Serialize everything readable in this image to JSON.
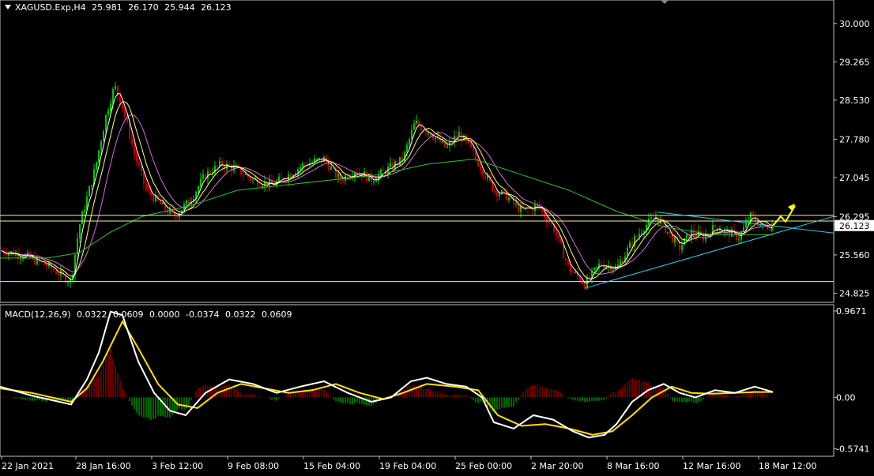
{
  "header": {
    "symbol": "XAGUSD.Exp,H4",
    "open": "25.981",
    "high": "26.170",
    "low": "25.944",
    "close": "26.123"
  },
  "price_axis": {
    "current_price_label": "26.123"
  },
  "macd": {
    "name": "MACD(12,26,9)",
    "values": [
      "0.0322",
      "0.0609",
      "0.0000",
      "-0.0374",
      "0.0322",
      "0.0609"
    ]
  },
  "colors": {
    "background": "#000000",
    "bull": "#00c800",
    "bear": "#c80000",
    "ma_fast": "#ffffff",
    "ma_mid": "#ffff66",
    "ma_slow": "#d070d0",
    "ma_long": "#30c030",
    "trendline": "#30c8e8",
    "hline": "#f0f0a0",
    "macd_line": "#ffffff",
    "signal_line": "#ffe000",
    "arrow": "#ffff00"
  },
  "chart_data": [
    {
      "type": "line",
      "panel": "price",
      "y_ticks": [
        "30.000",
        "29.265",
        "28.530",
        "27.780",
        "27.045",
        "26.295",
        "25.560",
        "24.825"
      ],
      "x_ticks": [
        "22 Jan 2021",
        "28 Jan 16:00",
        "3 Feb 12:00",
        "9 Feb 08:00",
        "15 Feb 04:00",
        "19 Feb 04:00",
        "25 Feb 00:00",
        "2 Mar 20:00",
        "8 Mar 16:00",
        "12 Mar 16:00",
        "18 Mar 12:00"
      ],
      "ylim": [
        24.65,
        30.3
      ],
      "close_path": [
        [
          0,
          25.65
        ],
        [
          30,
          25.55
        ],
        [
          60,
          25.35
        ],
        [
          90,
          25.05
        ],
        [
          100,
          26.1
        ],
        [
          120,
          27.2
        ],
        [
          135,
          28.3
        ],
        [
          145,
          28.8
        ],
        [
          155,
          28.4
        ],
        [
          170,
          27.5
        ],
        [
          185,
          26.8
        ],
        [
          205,
          26.5
        ],
        [
          220,
          26.3
        ],
        [
          240,
          26.6
        ],
        [
          260,
          27.1
        ],
        [
          280,
          27.3
        ],
        [
          300,
          27.2
        ],
        [
          320,
          27.0
        ],
        [
          345,
          26.9
        ],
        [
          365,
          27.1
        ],
        [
          385,
          27.3
        ],
        [
          410,
          27.4
        ],
        [
          430,
          27.0
        ],
        [
          450,
          27.2
        ],
        [
          470,
          27.0
        ],
        [
          490,
          27.2
        ],
        [
          510,
          27.4
        ],
        [
          525,
          28.1
        ],
        [
          545,
          27.9
        ],
        [
          565,
          27.6
        ],
        [
          580,
          27.9
        ],
        [
          595,
          27.6
        ],
        [
          610,
          27.2
        ],
        [
          625,
          26.8
        ],
        [
          640,
          26.7
        ],
        [
          660,
          26.4
        ],
        [
          680,
          26.5
        ],
        [
          700,
          26.1
        ],
        [
          720,
          25.3
        ],
        [
          740,
          25.0
        ],
        [
          760,
          25.4
        ],
        [
          780,
          25.3
        ],
        [
          800,
          25.8
        ],
        [
          815,
          26.1
        ],
        [
          830,
          26.3
        ],
        [
          845,
          26.0
        ],
        [
          860,
          25.7
        ],
        [
          875,
          26.0
        ],
        [
          890,
          25.9
        ],
        [
          905,
          26.1
        ],
        [
          920,
          26.0
        ],
        [
          935,
          25.9
        ],
        [
          950,
          26.3
        ],
        [
          965,
          26.1
        ],
        [
          978,
          26.12
        ]
      ],
      "ma_long_path": [
        [
          0,
          25.5
        ],
        [
          60,
          25.5
        ],
        [
          100,
          25.6
        ],
        [
          140,
          26.0
        ],
        [
          180,
          26.3
        ],
        [
          240,
          26.5
        ],
        [
          300,
          26.8
        ],
        [
          360,
          26.9
        ],
        [
          420,
          27.0
        ],
        [
          480,
          27.1
        ],
        [
          540,
          27.3
        ],
        [
          600,
          27.4
        ],
        [
          660,
          27.1
        ],
        [
          720,
          26.8
        ],
        [
          780,
          26.4
        ],
        [
          840,
          26.1
        ],
        [
          900,
          25.95
        ],
        [
          978,
          25.95
        ]
      ],
      "horizontal_levels": [
        26.32,
        26.21,
        25.05
      ],
      "triangle": {
        "upper": [
          [
            832,
            26.38
          ],
          [
            1055,
            25.98
          ]
        ],
        "lower": [
          [
            740,
            24.92
          ],
          [
            1055,
            26.3
          ]
        ]
      }
    },
    {
      "type": "bar",
      "panel": "macd",
      "y_ticks": [
        "0.9671",
        "0.00",
        "-0.5741"
      ],
      "ylim": [
        -0.66,
        1.02
      ],
      "macd_path": [
        [
          0,
          0.12
        ],
        [
          40,
          0.02
        ],
        [
          90,
          -0.08
        ],
        [
          110,
          0.2
        ],
        [
          125,
          0.5
        ],
        [
          140,
          0.96
        ],
        [
          155,
          0.92
        ],
        [
          175,
          0.4
        ],
        [
          195,
          0.05
        ],
        [
          215,
          -0.15
        ],
        [
          235,
          -0.2
        ],
        [
          260,
          0.05
        ],
        [
          290,
          0.2
        ],
        [
          320,
          0.15
        ],
        [
          350,
          0.05
        ],
        [
          380,
          0.12
        ],
        [
          410,
          0.18
        ],
        [
          440,
          0.05
        ],
        [
          470,
          -0.05
        ],
        [
          495,
          0.0
        ],
        [
          520,
          0.18
        ],
        [
          540,
          0.22
        ],
        [
          565,
          0.15
        ],
        [
          590,
          0.12
        ],
        [
          610,
          0.0
        ],
        [
          625,
          -0.28
        ],
        [
          650,
          -0.35
        ],
        [
          675,
          -0.2
        ],
        [
          700,
          -0.25
        ],
        [
          725,
          -0.38
        ],
        [
          745,
          -0.45
        ],
        [
          765,
          -0.42
        ],
        [
          780,
          -0.3
        ],
        [
          800,
          -0.05
        ],
        [
          820,
          0.08
        ],
        [
          840,
          0.15
        ],
        [
          860,
          0.05
        ],
        [
          880,
          0.0
        ],
        [
          905,
          0.08
        ],
        [
          930,
          0.05
        ],
        [
          955,
          0.12
        ],
        [
          978,
          0.06
        ]
      ],
      "signal_path": [
        [
          0,
          0.1
        ],
        [
          40,
          0.05
        ],
        [
          90,
          -0.05
        ],
        [
          110,
          0.1
        ],
        [
          130,
          0.4
        ],
        [
          155,
          0.85
        ],
        [
          175,
          0.55
        ],
        [
          200,
          0.15
        ],
        [
          225,
          -0.08
        ],
        [
          250,
          -0.12
        ],
        [
          275,
          0.05
        ],
        [
          305,
          0.15
        ],
        [
          335,
          0.1
        ],
        [
          365,
          0.05
        ],
        [
          395,
          0.08
        ],
        [
          425,
          0.15
        ],
        [
          455,
          0.05
        ],
        [
          485,
          -0.02
        ],
        [
          510,
          0.05
        ],
        [
          540,
          0.15
        ],
        [
          575,
          0.12
        ],
        [
          605,
          0.08
        ],
        [
          630,
          -0.2
        ],
        [
          660,
          -0.32
        ],
        [
          690,
          -0.3
        ],
        [
          720,
          -0.35
        ],
        [
          750,
          -0.42
        ],
        [
          775,
          -0.38
        ],
        [
          800,
          -0.2
        ],
        [
          825,
          0.0
        ],
        [
          850,
          0.12
        ],
        [
          875,
          0.05
        ],
        [
          900,
          0.04
        ],
        [
          930,
          0.05
        ],
        [
          955,
          0.06
        ],
        [
          978,
          0.06
        ]
      ]
    }
  ]
}
